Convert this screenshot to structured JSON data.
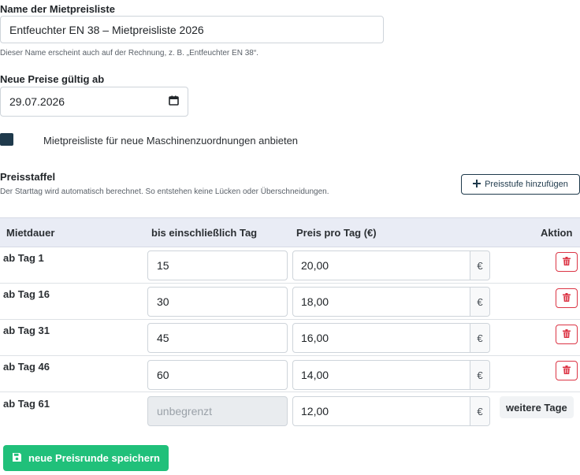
{
  "form": {
    "name_label": "Name der Mietpreisliste",
    "name_value": "Entfeuchter EN 38 – Mietpreisliste 2026",
    "name_help": "Dieser Name erscheint auch auf der Rechnung, z. B. „Entfeuchter EN 38“.",
    "date_label": "Neue Preise gültig ab",
    "date_value": "29.07.2026",
    "toggle_label": "Mietpreisliste für neue Maschinenzuordnungen anbieten"
  },
  "staffel": {
    "title": "Preisstaffel",
    "help": "Der Starttag wird automatisch berechnet. So entstehen keine Lücken oder Überschneidungen.",
    "add_button": "Preisstufe hinzufügen"
  },
  "table": {
    "headers": [
      "Mietdauer",
      "bis einschließlich Tag",
      "Preis pro Tag (€)",
      "Aktion"
    ],
    "currency": "€",
    "rows": [
      {
        "label": "ab Tag 1",
        "until": "15",
        "price": "20,00"
      },
      {
        "label": "ab Tag 16",
        "until": "30",
        "price": "18,00"
      },
      {
        "label": "ab Tag 31",
        "until": "45",
        "price": "16,00"
      },
      {
        "label": "ab Tag 46",
        "until": "60",
        "price": "14,00"
      },
      {
        "label": "ab Tag 61",
        "until_placeholder": "unbegrenzt",
        "price": "12,00",
        "action": "weitere Tage"
      }
    ]
  },
  "save_button": "neue Preisrunde speichern",
  "colors": {
    "primary": "#1f3a4c",
    "danger": "#dc3545",
    "success": "#20c07a",
    "table_header": "#e9ecf5"
  }
}
